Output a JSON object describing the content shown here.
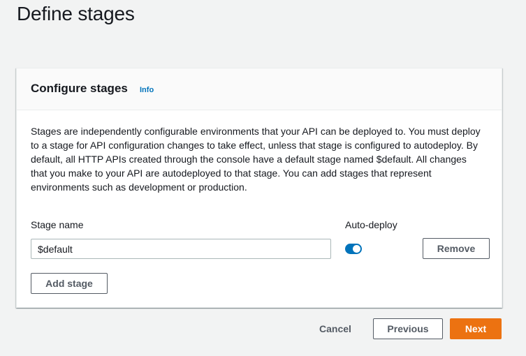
{
  "page": {
    "title": "Define stages"
  },
  "panel": {
    "title": "Configure stages",
    "info_link": "Info",
    "description": "Stages are independently configurable environments that your API can be deployed to. You must deploy to a stage for API configuration changes to take effect, unless that stage is configured to autodeploy. By default, all HTTP APIs created through the console have a default stage named $default. All changes that you make to your API are autodeployed to that stage. You can add stages that represent environments such as development or production."
  },
  "stage_form": {
    "stage_name_label": "Stage name",
    "auto_deploy_label": "Auto-deploy",
    "stage_name_value": "$default",
    "auto_deploy_enabled": true,
    "remove_label": "Remove",
    "add_stage_label": "Add stage"
  },
  "footer": {
    "cancel_label": "Cancel",
    "previous_label": "Previous",
    "next_label": "Next"
  },
  "colors": {
    "primary_action": "#ec7211",
    "link": "#0073bb",
    "toggle_on": "#0073bb"
  }
}
